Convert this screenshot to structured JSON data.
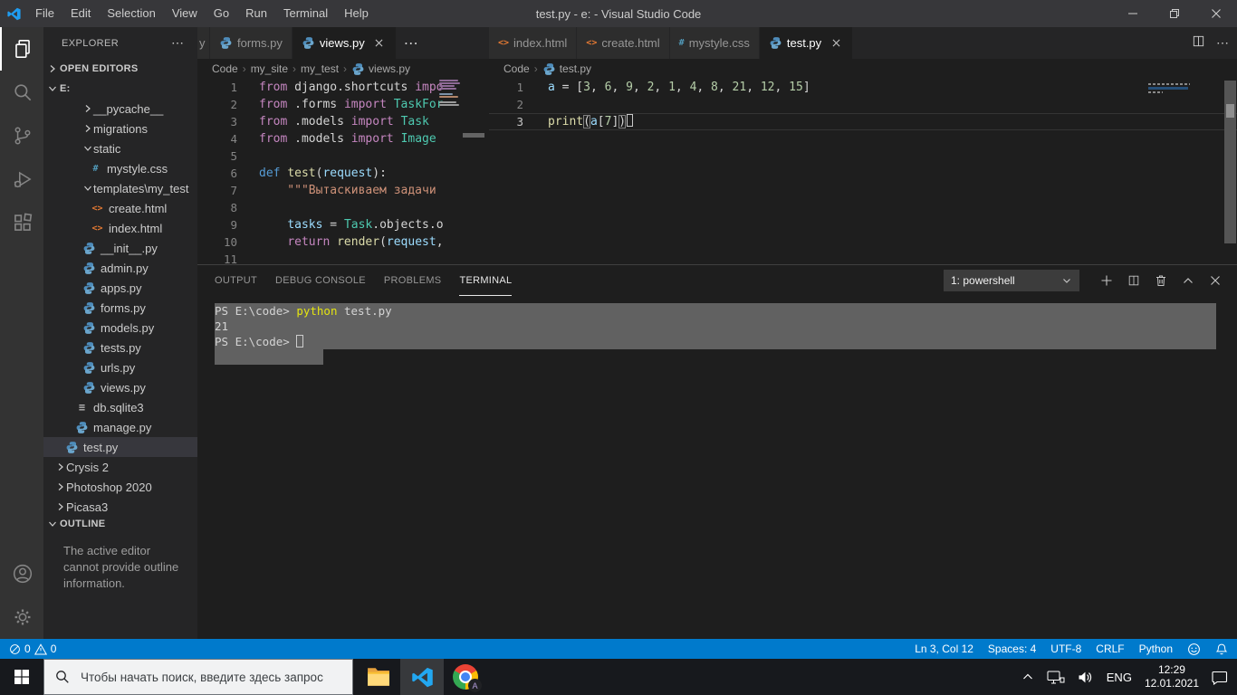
{
  "titlebar": {
    "title": "test.py - e: - Visual Studio Code",
    "menus": [
      "File",
      "Edit",
      "Selection",
      "View",
      "Go",
      "Run",
      "Terminal",
      "Help"
    ]
  },
  "activity_bar": {
    "top": [
      {
        "icon": "files",
        "active": true
      },
      {
        "icon": "search",
        "active": false
      },
      {
        "icon": "source-control",
        "active": false
      },
      {
        "icon": "debug",
        "active": false
      },
      {
        "icon": "extensions",
        "active": false
      }
    ],
    "bottom": [
      {
        "icon": "account",
        "active": false
      },
      {
        "icon": "gear",
        "active": false
      }
    ]
  },
  "sidebar": {
    "title": "EXPLORER",
    "open_editors_label": "OPEN EDITORS",
    "folder_label": "E:",
    "outline_label": "OUTLINE",
    "outline_message": "The active editor cannot provide outline information.",
    "tree": [
      {
        "label": "__pycache__",
        "type": "folder",
        "chevron": "right",
        "indent": 43
      },
      {
        "label": "migrations",
        "type": "folder",
        "chevron": "right",
        "indent": 43
      },
      {
        "label": "static",
        "type": "folder",
        "chevron": "down",
        "indent": 43
      },
      {
        "label": "mystyle.css",
        "type": "css",
        "indent": 49
      },
      {
        "label": "templates\\my_test",
        "type": "folder",
        "chevron": "down",
        "indent": 43
      },
      {
        "label": "create.html",
        "type": "html",
        "indent": 51
      },
      {
        "label": "index.html",
        "type": "html",
        "indent": 51
      },
      {
        "label": "__init__.py",
        "type": "python",
        "indent": 42
      },
      {
        "label": "admin.py",
        "type": "python",
        "indent": 42
      },
      {
        "label": "apps.py",
        "type": "python",
        "indent": 42
      },
      {
        "label": "forms.py",
        "type": "python",
        "indent": 42
      },
      {
        "label": "models.py",
        "type": "python",
        "indent": 42
      },
      {
        "label": "tests.py",
        "type": "python",
        "indent": 42
      },
      {
        "label": "urls.py",
        "type": "python",
        "indent": 42
      },
      {
        "label": "views.py",
        "type": "python",
        "indent": 42
      },
      {
        "label": "db.sqlite3",
        "type": "db",
        "indent": 34
      },
      {
        "label": "manage.py",
        "type": "python",
        "indent": 34
      },
      {
        "label": "test.py",
        "type": "python",
        "indent": 23,
        "selected": true
      },
      {
        "label": "Crysis 2",
        "type": "folder",
        "chevron": "right",
        "indent": 13
      },
      {
        "label": "Photoshop 2020",
        "type": "folder",
        "chevron": "right",
        "indent": 13
      },
      {
        "label": "Picasa3",
        "type": "folder",
        "chevron": "right",
        "indent": 13
      }
    ]
  },
  "editor_groups": [
    {
      "id": "left",
      "tabs": [
        {
          "label": "y",
          "fragment": true
        },
        {
          "label": "forms.py",
          "icon": "python"
        },
        {
          "label": "views.py",
          "icon": "python",
          "active": true,
          "close": true
        }
      ],
      "overflow_dots": "⋯",
      "breadcrumb": {
        "parts": [
          "Code",
          "my_site",
          "my_test"
        ],
        "file": "views.py",
        "file_icon": "python"
      },
      "code": [
        {
          "n": 1,
          "tokens": [
            [
              "kw",
              "from"
            ],
            [
              "t",
              " django.shortcuts "
            ],
            [
              "kw",
              "impo"
            ]
          ]
        },
        {
          "n": 2,
          "tokens": [
            [
              "kw",
              "from"
            ],
            [
              "t",
              " .forms "
            ],
            [
              "kw",
              "import"
            ],
            [
              "t",
              " "
            ],
            [
              "cls",
              "TaskFor"
            ]
          ]
        },
        {
          "n": 3,
          "tokens": [
            [
              "kw",
              "from"
            ],
            [
              "t",
              " .models "
            ],
            [
              "kw",
              "import"
            ],
            [
              "t",
              " "
            ],
            [
              "cls",
              "Task"
            ]
          ]
        },
        {
          "n": 4,
          "tokens": [
            [
              "kw",
              "from"
            ],
            [
              "t",
              " .models "
            ],
            [
              "kw",
              "import"
            ],
            [
              "t",
              " "
            ],
            [
              "cls",
              "Image"
            ]
          ]
        },
        {
          "n": 5,
          "tokens": []
        },
        {
          "n": 6,
          "tokens": [
            [
              "def",
              "def"
            ],
            [
              "t",
              " "
            ],
            [
              "fn",
              "test"
            ],
            [
              "t",
              "("
            ],
            [
              "var",
              "request"
            ],
            [
              "t",
              "):"
            ]
          ]
        },
        {
          "n": 7,
          "tokens": [
            [
              "str",
              "    \"\"\"Вытаскиваем задачи "
            ]
          ]
        },
        {
          "n": 8,
          "tokens": []
        },
        {
          "n": 9,
          "tokens": [
            [
              "t",
              "    "
            ],
            [
              "var",
              "tasks"
            ],
            [
              "t",
              " = "
            ],
            [
              "cls",
              "Task"
            ],
            [
              "t",
              ".objects.o"
            ]
          ]
        },
        {
          "n": 10,
          "tokens": [
            [
              "t",
              "    "
            ],
            [
              "kw",
              "return"
            ],
            [
              "t",
              " "
            ],
            [
              "fn",
              "render"
            ],
            [
              "t",
              "("
            ],
            [
              "var",
              "request"
            ],
            [
              "t",
              ","
            ]
          ]
        },
        {
          "n": 11,
          "tokens": []
        }
      ]
    },
    {
      "id": "right",
      "tabs": [
        {
          "label": "index.html",
          "icon": "html"
        },
        {
          "label": "create.html",
          "icon": "html"
        },
        {
          "label": "mystyle.css",
          "icon": "css"
        },
        {
          "label": "test.py",
          "icon": "python",
          "active": true,
          "close": true
        }
      ],
      "breadcrumb": {
        "parts": [
          "Code"
        ],
        "file": "test.py",
        "file_icon": "python"
      },
      "code": [
        {
          "n": 1,
          "tokens": [
            [
              "var",
              "a"
            ],
            [
              "t",
              " = ["
            ],
            [
              "num",
              "3"
            ],
            [
              "t",
              ", "
            ],
            [
              "num",
              "6"
            ],
            [
              "t",
              ", "
            ],
            [
              "num",
              "9"
            ],
            [
              "t",
              ", "
            ],
            [
              "num",
              "2"
            ],
            [
              "t",
              ", "
            ],
            [
              "num",
              "1"
            ],
            [
              "t",
              ", "
            ],
            [
              "num",
              "4"
            ],
            [
              "t",
              ", "
            ],
            [
              "num",
              "8"
            ],
            [
              "t",
              ", "
            ],
            [
              "num",
              "21"
            ],
            [
              "t",
              ", "
            ],
            [
              "num",
              "12"
            ],
            [
              "t",
              ", "
            ],
            [
              "num",
              "15"
            ],
            [
              "t",
              "]"
            ]
          ]
        },
        {
          "n": 2,
          "tokens": []
        },
        {
          "n": 3,
          "current": true,
          "tokens": [
            [
              "fn",
              "print"
            ],
            [
              "bm",
              "("
            ],
            [
              "var",
              "a"
            ],
            [
              "t",
              "["
            ],
            [
              "num",
              "7"
            ],
            [
              "t",
              "]"
            ],
            [
              "bm",
              ")"
            ],
            [
              "caret",
              ""
            ]
          ]
        }
      ]
    }
  ],
  "panel": {
    "tabs": [
      "OUTPUT",
      "DEBUG CONSOLE",
      "PROBLEMS",
      "TERMINAL"
    ],
    "active_tab": "TERMINAL",
    "dropdown_label": "1: powershell",
    "terminal_lines": [
      {
        "sel": "full",
        "tokens": [
          [
            "t",
            "PS E:\\code> "
          ],
          [
            "y",
            "python"
          ],
          [
            "t",
            " test.py"
          ]
        ]
      },
      {
        "sel": "full",
        "tokens": [
          [
            "t",
            "21"
          ]
        ]
      },
      {
        "sel": "full",
        "tokens": [
          [
            "t",
            "PS E:\\code> "
          ],
          [
            "cur",
            ""
          ]
        ]
      },
      {
        "sel": "part",
        "tokens": []
      }
    ]
  },
  "status_bar": {
    "errors": "0",
    "warnings": "0",
    "items_right": [
      "Ln 3, Col 12",
      "Spaces: 4",
      "UTF-8",
      "CRLF",
      "Python"
    ]
  },
  "taskbar": {
    "search_placeholder": "Чтобы начать поиск, введите здесь запрос",
    "language": "ENG",
    "time": "12:29",
    "date": "12.01.2021",
    "chrome_badge": "A"
  }
}
